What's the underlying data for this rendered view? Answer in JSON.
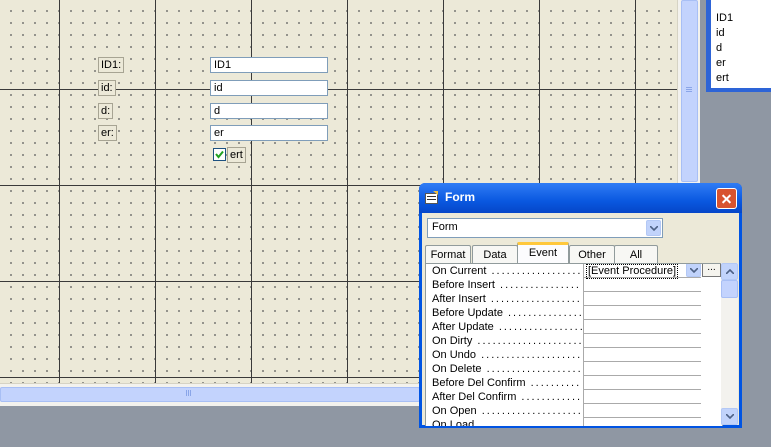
{
  "form_design": {
    "labels": [
      "ID1:",
      "id:",
      "d:",
      "er:"
    ],
    "textboxes": [
      "ID1",
      "id",
      "d",
      "er"
    ],
    "checkbox_label": "ert",
    "checkbox_checked": true
  },
  "field_list": {
    "items": [
      "ID1",
      "id",
      "d",
      "er",
      "ert"
    ]
  },
  "property_sheet": {
    "title": "Form",
    "selector_value": "Form",
    "tabs": [
      "Format",
      "Data",
      "Event",
      "Other",
      "All"
    ],
    "active_tab": "Event",
    "properties": [
      {
        "name": "On Current",
        "value": "[Event Procedure]"
      },
      {
        "name": "Before Insert",
        "value": ""
      },
      {
        "name": "After Insert",
        "value": ""
      },
      {
        "name": "Before Update",
        "value": ""
      },
      {
        "name": "After Update",
        "value": ""
      },
      {
        "name": "On Dirty",
        "value": ""
      },
      {
        "name": "On Undo",
        "value": ""
      },
      {
        "name": "On Delete",
        "value": ""
      },
      {
        "name": "Before Del Confirm",
        "value": ""
      },
      {
        "name": "After Del Confirm",
        "value": ""
      },
      {
        "name": "On Open",
        "value": ""
      },
      {
        "name": "On Load",
        "value": ""
      }
    ],
    "build_button": "..."
  }
}
